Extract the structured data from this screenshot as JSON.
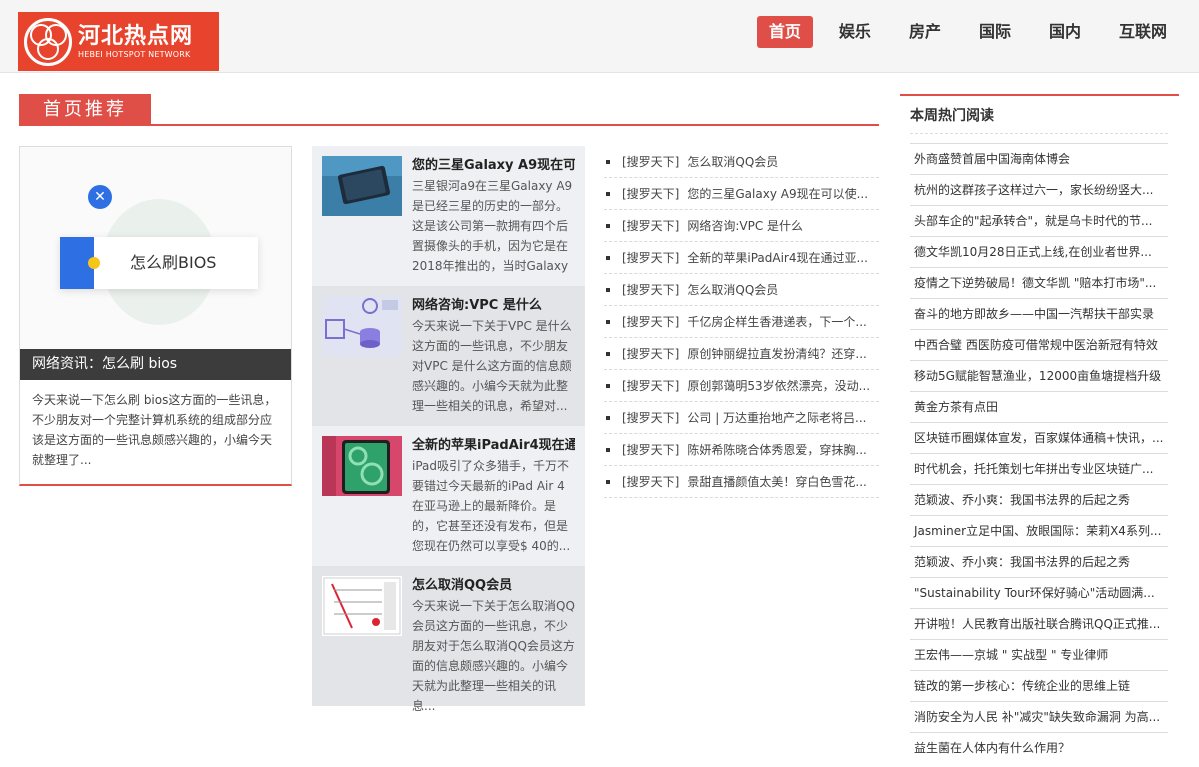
{
  "header": {
    "logo_cn": "河北热点网",
    "logo_en": "HEBEI HOTSPOT NETWORK",
    "nav": [
      "首页",
      "娱乐",
      "房产",
      "国际",
      "国内",
      "互联网"
    ],
    "active_nav": "首页",
    "accent": "#e04e48"
  },
  "section": {
    "title": "首页推荐"
  },
  "feature": {
    "image_text": "怎么刷BIOS",
    "caption": "网络资讯：怎么刷 bios",
    "desc": "今天来说一下怎么刷 bios这方面的一些讯息，不少朋友对一个完整计算机系统的组成部分应该是这方面的一些讯息颇感兴趣的，小编今天就整理了..."
  },
  "mid_items": [
    {
      "title": "您的三星Galaxy A9现在可",
      "body": "三星银河a9在三星Galaxy A9是已经三星的历史的一部分。这是该公司第一款拥有四个后置摄像头的手机，因为它是在2018年推出的，当时Galaxy ...",
      "thumb": "phone"
    },
    {
      "title": "网络咨询:VPC 是什么",
      "body": "今天来说一下关于VPC 是什么这方面的一些讯息，不少朋友对VPC 是什么这方面的信息颇感兴趣的。小编今天就为此整理一些相关的讯息，希望对...",
      "thumb": "vpc"
    },
    {
      "title": "全新的苹果iPadAir4现在通",
      "body": "iPad吸引了众多猎手，千万不要错过今天最新的iPad Air 4在亚马逊上的最新降价。是的，它甚至还没有发布，但是您现在仍然可以享受$ 40的...",
      "thumb": "ipad"
    },
    {
      "title": "怎么取消QQ会员",
      "body": "今天来说一下关于怎么取消QQ会员这方面的一些讯息，不少朋友对于怎么取消QQ会员这方面的信息颇感兴趣的。小编今天就为此整理一些相关的讯息...",
      "thumb": "qq"
    }
  ],
  "link_list": [
    {
      "src": "[搜罗天下]",
      "title": "怎么取消QQ会员"
    },
    {
      "src": "[搜罗天下]",
      "title": "您的三星Galaxy A9现在可以使..."
    },
    {
      "src": "[搜罗天下]",
      "title": "网络咨询:VPC 是什么"
    },
    {
      "src": "[搜罗天下]",
      "title": "全新的苹果iPadAir4现在通过亚..."
    },
    {
      "src": "[搜罗天下]",
      "title": "怎么取消QQ会员"
    },
    {
      "src": "[搜罗天下]",
      "title": "千亿房企样生香港递表，下一个..."
    },
    {
      "src": "[搜罗天下]",
      "title": "原创钟丽缇拉直发扮清纯？还穿..."
    },
    {
      "src": "[搜罗天下]",
      "title": "原创郭蔼明53岁依然漂亮，没动..."
    },
    {
      "src": "[搜罗天下]",
      "title": "公司 | 万达重抬地产之际老将吕..."
    },
    {
      "src": "[搜罗天下]",
      "title": "陈妍希陈晓合体秀恩爱，穿抹胸..."
    },
    {
      "src": "[搜罗天下]",
      "title": "景甜直播颜值太美！穿白色雪花..."
    }
  ],
  "sidebar": {
    "title": "本周热门阅读",
    "items": [
      "外商盛赞首届中国海南体博会",
      "杭州的这群孩子这样过六一，家长纷纷竖大...",
      "头部车企的\"起承转合\"，就是乌卡时代的节...",
      "德文华凯10月28日正式上线,在创业者世界...",
      "疫情之下逆势破局！德文华凯 \"赔本打市场\"...",
      "奋斗的地方即故乡——中国一汽帮扶干部实录",
      "中西合璧 西医防疫可借常规中医治新冠有特效",
      "移动5G赋能智慧渔业，12000亩鱼塘提档升级",
      "黄金方茶有点田",
      "区块链币圈媒体宣发，百家媒体通稿+快讯，...",
      "时代机会，托托策划七年拼出专业区块链广...",
      "范颖波、乔小爽：我国书法界的后起之秀",
      "Jasminer立足中国、放眼国际：茉莉X4系列...",
      "范颖波、乔小爽：我国书法界的后起之秀",
      "\"Sustainability Tour环保好骑心\"活动圆满...",
      "开讲啦！人民教育出版社联合腾讯QQ正式推...",
      "王宏伟——京城 \" 实战型 \" 专业律师",
      "链改的第一步核心：传统企业的思维上链",
      "消防安全为人民 补\"减灾\"缺失致命漏洞 为高...",
      "益生菌在人体内有什么作用？"
    ]
  }
}
